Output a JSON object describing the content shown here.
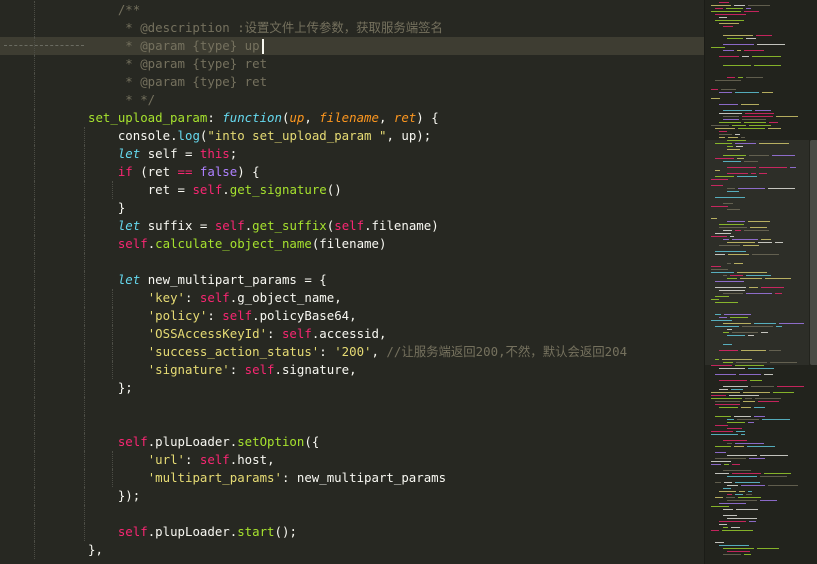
{
  "colors": {
    "background": "#272822",
    "comment": "#75715e",
    "string": "#e6db74",
    "keyword": "#f92672",
    "storage": "#66d9ef",
    "function": "#a6e22e",
    "param": "#fd971f",
    "constant": "#ae81ff",
    "text": "#f8f8f2"
  },
  "code": {
    "active_line_index": 2,
    "lines": [
      {
        "indent": 0,
        "tokens": [
          {
            "t": "    /**",
            "c": "comment"
          }
        ]
      },
      {
        "indent": 0,
        "tokens": [
          {
            "t": "     * @description :设置文件上传参数，获取服务端签名",
            "c": "comment"
          }
        ]
      },
      {
        "indent": 0,
        "tokens": [
          {
            "t": "     * @param {type} up",
            "c": "comment"
          }
        ]
      },
      {
        "indent": 0,
        "tokens": [
          {
            "t": "     * @param {type} ret",
            "c": "comment"
          }
        ]
      },
      {
        "indent": 0,
        "tokens": [
          {
            "t": "     * @param {type} ret",
            "c": "comment"
          }
        ]
      },
      {
        "indent": 0,
        "tokens": [
          {
            "t": "     * */",
            "c": "comment"
          }
        ]
      },
      {
        "indent": 0,
        "tokens": [
          {
            "t": "set_upload_param",
            "c": "function"
          },
          {
            "t": ": ",
            "c": "plain"
          },
          {
            "t": "function",
            "c": "storage"
          },
          {
            "t": "(",
            "c": "plain"
          },
          {
            "t": "up",
            "c": "param"
          },
          {
            "t": ", ",
            "c": "plain"
          },
          {
            "t": "filename",
            "c": "param"
          },
          {
            "t": ", ",
            "c": "plain"
          },
          {
            "t": "ret",
            "c": "param"
          },
          {
            "t": ") {",
            "c": "plain"
          }
        ]
      },
      {
        "indent": 1,
        "tokens": [
          {
            "t": "console",
            "c": "plain"
          },
          {
            "t": ".",
            "c": "plain"
          },
          {
            "t": "log",
            "c": "method"
          },
          {
            "t": "(",
            "c": "plain"
          },
          {
            "t": "\"into set_upload_param \"",
            "c": "string"
          },
          {
            "t": ", up);",
            "c": "plain"
          }
        ]
      },
      {
        "indent": 1,
        "tokens": [
          {
            "t": "let",
            "c": "storage"
          },
          {
            "t": " self = ",
            "c": "plain"
          },
          {
            "t": "this",
            "c": "self"
          },
          {
            "t": ";",
            "c": "plain"
          }
        ]
      },
      {
        "indent": 1,
        "tokens": [
          {
            "t": "if",
            "c": "keyword"
          },
          {
            "t": " (ret ",
            "c": "plain"
          },
          {
            "t": "==",
            "c": "keyword"
          },
          {
            "t": " ",
            "c": "plain"
          },
          {
            "t": "false",
            "c": "const"
          },
          {
            "t": ") {",
            "c": "plain"
          }
        ]
      },
      {
        "indent": 2,
        "tokens": [
          {
            "t": "ret = ",
            "c": "plain"
          },
          {
            "t": "self",
            "c": "self"
          },
          {
            "t": ".",
            "c": "plain"
          },
          {
            "t": "get_signature",
            "c": "func"
          },
          {
            "t": "()",
            "c": "plain"
          }
        ]
      },
      {
        "indent": 1,
        "tokens": [
          {
            "t": "}",
            "c": "plain"
          }
        ]
      },
      {
        "indent": 1,
        "tokens": [
          {
            "t": "let",
            "c": "storage"
          },
          {
            "t": " suffix = ",
            "c": "plain"
          },
          {
            "t": "self",
            "c": "self"
          },
          {
            "t": ".",
            "c": "plain"
          },
          {
            "t": "get_suffix",
            "c": "func"
          },
          {
            "t": "(",
            "c": "plain"
          },
          {
            "t": "self",
            "c": "self"
          },
          {
            "t": ".filename)",
            "c": "plain"
          }
        ]
      },
      {
        "indent": 1,
        "tokens": [
          {
            "t": "self",
            "c": "self"
          },
          {
            "t": ".",
            "c": "plain"
          },
          {
            "t": "calculate_object_name",
            "c": "func"
          },
          {
            "t": "(filename)",
            "c": "plain"
          }
        ]
      },
      {
        "indent": 1,
        "tokens": []
      },
      {
        "indent": 1,
        "tokens": [
          {
            "t": "let",
            "c": "storage"
          },
          {
            "t": " new_multipart_params = {",
            "c": "plain"
          }
        ]
      },
      {
        "indent": 2,
        "tokens": [
          {
            "t": "'key'",
            "c": "string"
          },
          {
            "t": ": ",
            "c": "plain"
          },
          {
            "t": "self",
            "c": "self"
          },
          {
            "t": ".g_object_name,",
            "c": "plain"
          }
        ]
      },
      {
        "indent": 2,
        "tokens": [
          {
            "t": "'policy'",
            "c": "string"
          },
          {
            "t": ": ",
            "c": "plain"
          },
          {
            "t": "self",
            "c": "self"
          },
          {
            "t": ".policyBase64,",
            "c": "plain"
          }
        ]
      },
      {
        "indent": 2,
        "tokens": [
          {
            "t": "'OSSAccessKeyId'",
            "c": "string"
          },
          {
            "t": ": ",
            "c": "plain"
          },
          {
            "t": "self",
            "c": "self"
          },
          {
            "t": ".accessid,",
            "c": "plain"
          }
        ]
      },
      {
        "indent": 2,
        "tokens": [
          {
            "t": "'success_action_status'",
            "c": "string"
          },
          {
            "t": ": ",
            "c": "plain"
          },
          {
            "t": "'200'",
            "c": "string"
          },
          {
            "t": ", ",
            "c": "plain"
          },
          {
            "t": "//让服务端返回200,不然，默认会返回204",
            "c": "comment"
          }
        ]
      },
      {
        "indent": 2,
        "tokens": [
          {
            "t": "'signature'",
            "c": "string"
          },
          {
            "t": ": ",
            "c": "plain"
          },
          {
            "t": "self",
            "c": "self"
          },
          {
            "t": ".signature,",
            "c": "plain"
          }
        ]
      },
      {
        "indent": 1,
        "tokens": [
          {
            "t": "};",
            "c": "plain"
          }
        ]
      },
      {
        "indent": 1,
        "tokens": []
      },
      {
        "indent": 1,
        "tokens": []
      },
      {
        "indent": 1,
        "tokens": [
          {
            "t": "self",
            "c": "self"
          },
          {
            "t": ".plupLoader.",
            "c": "plain"
          },
          {
            "t": "setOption",
            "c": "func"
          },
          {
            "t": "({",
            "c": "plain"
          }
        ]
      },
      {
        "indent": 2,
        "tokens": [
          {
            "t": "'url'",
            "c": "string"
          },
          {
            "t": ": ",
            "c": "plain"
          },
          {
            "t": "self",
            "c": "self"
          },
          {
            "t": ".host,",
            "c": "plain"
          }
        ]
      },
      {
        "indent": 2,
        "tokens": [
          {
            "t": "'multipart_params'",
            "c": "string"
          },
          {
            "t": ": new_multipart_params",
            "c": "plain"
          }
        ]
      },
      {
        "indent": 1,
        "tokens": [
          {
            "t": "});",
            "c": "plain"
          }
        ]
      },
      {
        "indent": 1,
        "tokens": []
      },
      {
        "indent": 1,
        "tokens": [
          {
            "t": "self",
            "c": "self"
          },
          {
            "t": ".plupLoader.",
            "c": "plain"
          },
          {
            "t": "start",
            "c": "func"
          },
          {
            "t": "();",
            "c": "plain"
          }
        ]
      },
      {
        "indent": 0,
        "tokens": [
          {
            "t": "},",
            "c": "plain"
          }
        ]
      }
    ]
  }
}
